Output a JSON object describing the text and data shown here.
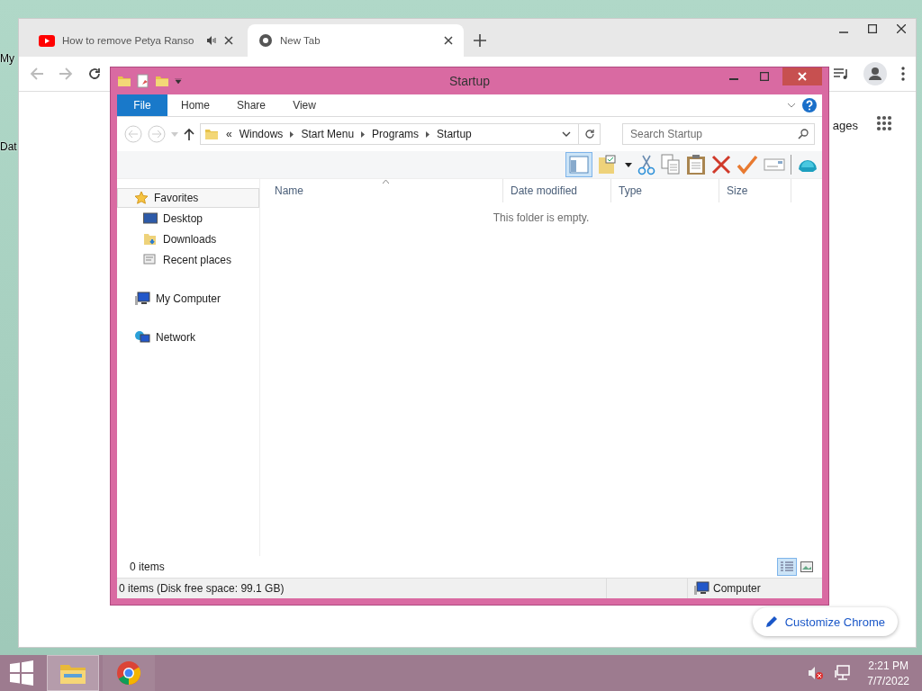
{
  "desktop": {
    "icon_labels": [
      "My",
      "Dat"
    ]
  },
  "browser": {
    "tabs": [
      {
        "title": "How to remove Petya Ranso",
        "selected": false,
        "audio": true
      },
      {
        "title": "New Tab",
        "selected": true,
        "audio": false
      }
    ],
    "page": {
      "link_fragment": "ages",
      "customize_button": "Customize Chrome"
    }
  },
  "explorer": {
    "title": "Startup",
    "ribbon_tabs": [
      {
        "label": "File",
        "selected": true
      },
      {
        "label": "Home",
        "selected": false
      },
      {
        "label": "Share",
        "selected": false
      },
      {
        "label": "View",
        "selected": false
      }
    ],
    "address": {
      "prefix": "«",
      "crumbs": [
        "Windows",
        "Start Menu",
        "Programs",
        "Startup"
      ]
    },
    "search": {
      "placeholder": "Search Startup"
    },
    "nav": [
      {
        "label": "Favorites",
        "kind": "favorites",
        "selected": true,
        "children": [
          {
            "label": "Desktop",
            "kind": "desktop",
            "selected": false
          },
          {
            "label": "Downloads",
            "kind": "downloads",
            "selected": false
          },
          {
            "label": "Recent places",
            "kind": "recent",
            "selected": false
          }
        ]
      },
      {
        "label": "My Computer",
        "kind": "computer",
        "selected": false
      },
      {
        "label": "Network",
        "kind": "network",
        "selected": false
      }
    ],
    "columns": [
      "Name",
      "Date modified",
      "Type",
      "Size"
    ],
    "empty_message": "This folder is empty.",
    "item_count": "0 items",
    "views": [
      {
        "kind": "details",
        "selected": true
      },
      {
        "kind": "thumbnails",
        "selected": false
      }
    ],
    "status": {
      "text": "0 items (Disk free space: 99.1 GB)",
      "location": "Computer"
    }
  },
  "taskbar": {
    "buttons": [
      {
        "kind": "explorer",
        "selected": true
      },
      {
        "kind": "chrome",
        "selected": false
      }
    ],
    "volume_muted": true,
    "clock": {
      "time": "2:21 PM",
      "date": "7/7/2022"
    }
  }
}
